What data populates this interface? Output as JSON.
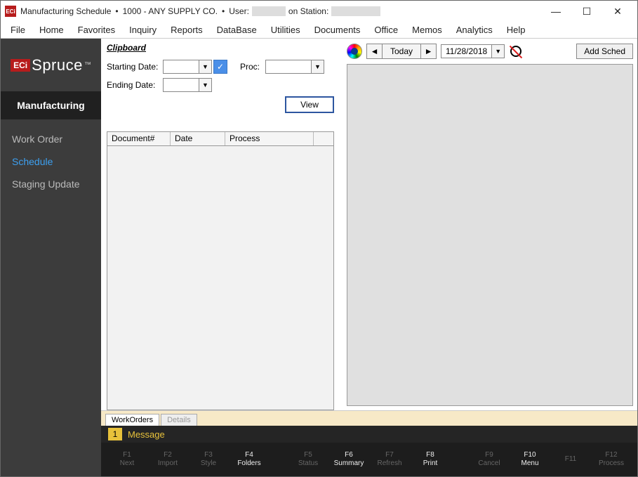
{
  "titlebar": {
    "app": "Manufacturing Schedule",
    "company": "1000 - ANY SUPPLY CO.",
    "user_label": "User:",
    "station_label": "on Station:"
  },
  "menu": [
    "File",
    "Home",
    "Favorites",
    "Inquiry",
    "Reports",
    "DataBase",
    "Utilities",
    "Documents",
    "Office",
    "Memos",
    "Analytics",
    "Help"
  ],
  "brand": {
    "logo": "ECi",
    "name": "Spruce"
  },
  "sidebar": {
    "header": "Manufacturing",
    "items": [
      {
        "label": "Work Order",
        "active": false
      },
      {
        "label": "Schedule",
        "active": true
      },
      {
        "label": "Staging Update",
        "active": false
      }
    ]
  },
  "clipboard": {
    "title": "Clipboard",
    "start_label": "Starting Date:",
    "end_label": "Ending Date:",
    "proc_label": "Proc:",
    "view": "View",
    "columns": [
      "Document#",
      "Date",
      "Process"
    ]
  },
  "sched_toolbar": {
    "today": "Today",
    "date": "11/28/2018",
    "add": "Add Sched"
  },
  "tabs": {
    "active": "WorkOrders",
    "inactive": "Details"
  },
  "status": {
    "count": "1",
    "message": "Message"
  },
  "fkeys": [
    {
      "k": "F1",
      "l": "Next",
      "on": false
    },
    {
      "k": "F2",
      "l": "Import",
      "on": false
    },
    {
      "k": "F3",
      "l": "Style",
      "on": false
    },
    {
      "k": "F4",
      "l": "Folders",
      "on": true
    },
    {
      "gap": true
    },
    {
      "k": "F5",
      "l": "Status",
      "on": false
    },
    {
      "k": "F6",
      "l": "Summary",
      "on": true
    },
    {
      "k": "F7",
      "l": "Refresh",
      "on": false
    },
    {
      "k": "F8",
      "l": "Print",
      "on": true
    },
    {
      "gap": true
    },
    {
      "k": "F9",
      "l": "Cancel",
      "on": false
    },
    {
      "k": "F10",
      "l": "Menu",
      "on": true
    },
    {
      "k": "F11",
      "l": "",
      "on": false
    },
    {
      "k": "F12",
      "l": "Process",
      "on": false
    }
  ]
}
